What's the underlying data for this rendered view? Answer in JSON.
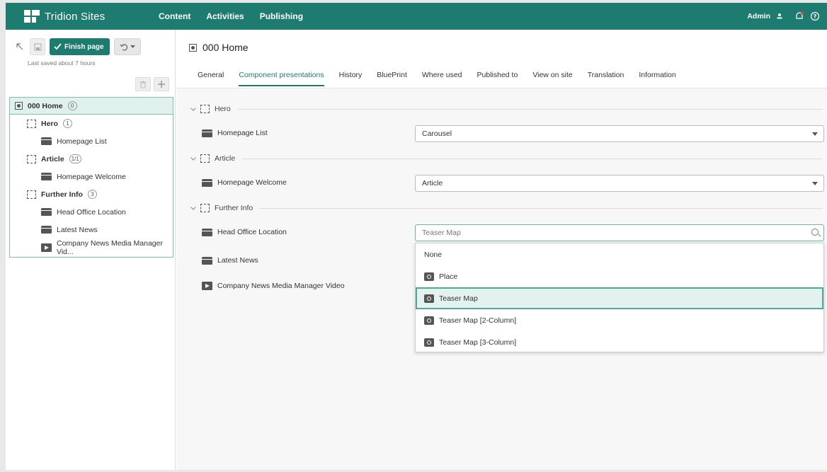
{
  "app": {
    "brand": "Tridion Sites",
    "nav": [
      "Content",
      "Activities",
      "Publishing"
    ],
    "user": "Admin"
  },
  "colors": {
    "accent": "#1e7b6f",
    "selection": "#e3f2ef"
  },
  "left": {
    "finish_label": "Finish page",
    "saved_text": "Last saved about 7 hours",
    "tree": {
      "root": {
        "label": "000 Home",
        "badge": "0"
      },
      "items": [
        {
          "label": "Hero",
          "badge": "1",
          "type": "region"
        },
        {
          "label": "Homepage List",
          "type": "component"
        },
        {
          "label": "Article",
          "badge": "1/1",
          "type": "region"
        },
        {
          "label": "Homepage Welcome",
          "type": "component"
        },
        {
          "label": "Further Info",
          "badge": "3",
          "type": "region"
        },
        {
          "label": "Head Office Location",
          "type": "component"
        },
        {
          "label": "Latest News",
          "type": "component"
        },
        {
          "label": "Company News Media Manager Vid...",
          "type": "video"
        }
      ]
    }
  },
  "main": {
    "page_title": "000 Home",
    "tabs": [
      "General",
      "Component presentations",
      "History",
      "BluePrint",
      "Where used",
      "Published to",
      "View on site",
      "Translation",
      "Information"
    ],
    "active_tab": "Component presentations",
    "sections": {
      "hero": "Hero",
      "article": "Article",
      "further": "Further Info"
    },
    "rows": {
      "homepage_list": {
        "label": "Homepage List",
        "value": "Carousel"
      },
      "homepage_welcome": {
        "label": "Homepage Welcome",
        "value": "Article"
      },
      "head_office": {
        "label": "Head Office Location",
        "placeholder": "Teaser Map"
      },
      "latest_news": {
        "label": "Latest News"
      },
      "company_news": {
        "label": "Company News Media Manager Video"
      }
    },
    "dropdown": {
      "options": [
        "None",
        "Place",
        "Teaser Map",
        "Teaser Map [2-Column]",
        "Teaser Map [3-Column]"
      ],
      "selected": "Teaser Map"
    }
  }
}
